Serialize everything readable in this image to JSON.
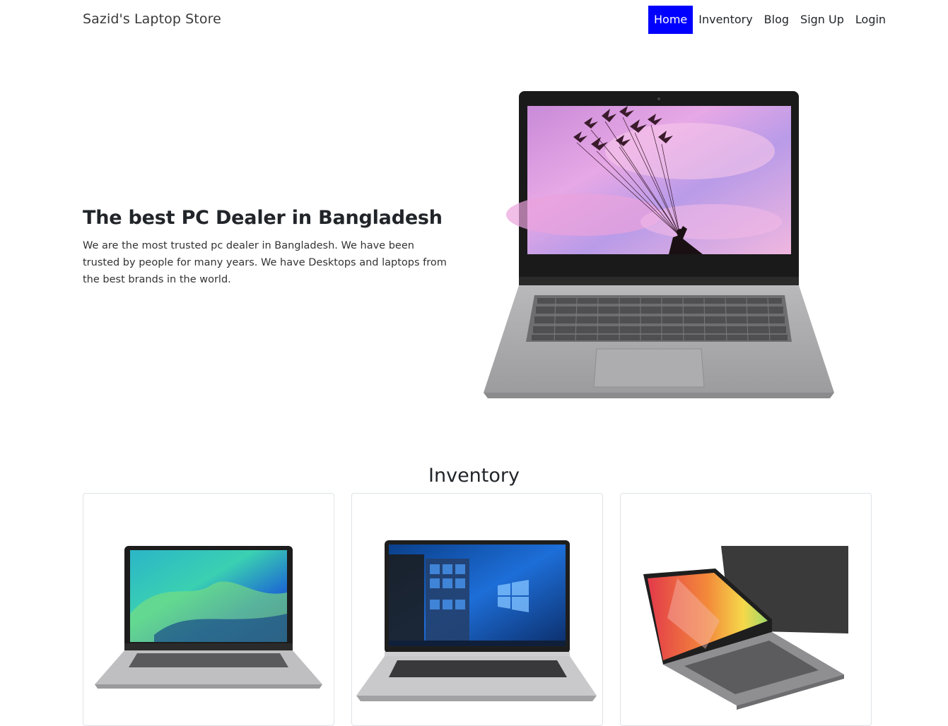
{
  "navbar": {
    "brand": "Sazid's Laptop Store",
    "links": [
      {
        "label": "Home",
        "active": true
      },
      {
        "label": "Inventory",
        "active": false
      },
      {
        "label": "Blog",
        "active": false
      },
      {
        "label": "Sign Up",
        "active": false
      },
      {
        "label": "Login",
        "active": false
      }
    ]
  },
  "hero": {
    "title": "The best PC Dealer in Bangladesh",
    "description": "We are the most trusted pc dealer in Bangladesh. We have been trusted by people for many years. We have Desktops and laptops from the best brands in the world."
  },
  "inventory": {
    "title": "Inventory"
  },
  "colors": {
    "accent": "#0000ff",
    "text": "#212529",
    "card_border": "#dfe3e7"
  }
}
